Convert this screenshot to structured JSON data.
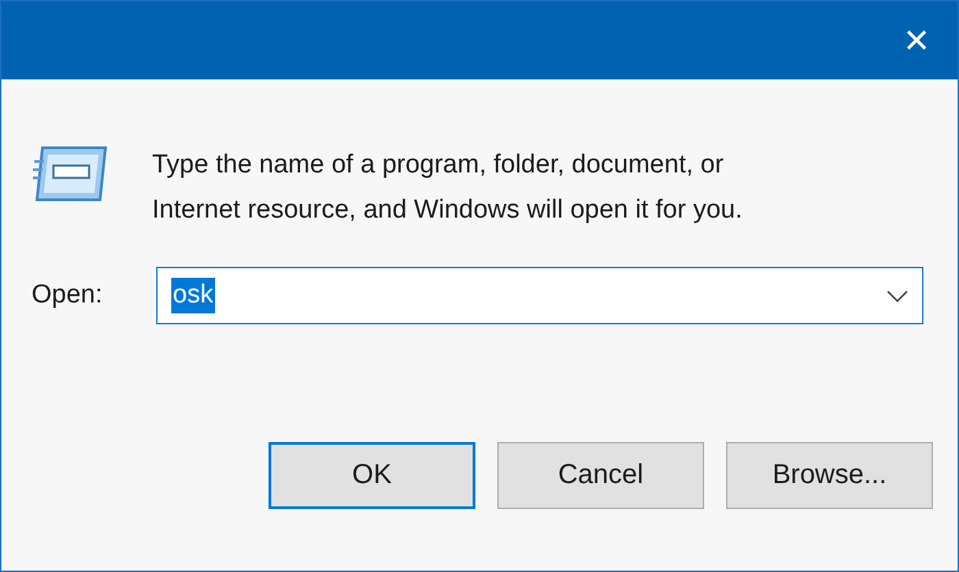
{
  "window": {
    "close": "✕"
  },
  "description": [
    "Type the name of a program, folder, document, or",
    "Internet resource, and Windows will open it for you."
  ],
  "open_field": {
    "label": "Open:",
    "value": "osk",
    "value_selected": true
  },
  "buttons": [
    {
      "label": "OK",
      "default": true
    },
    {
      "label": "Cancel",
      "default": false
    },
    {
      "label": "Browse...",
      "default": false
    }
  ]
}
